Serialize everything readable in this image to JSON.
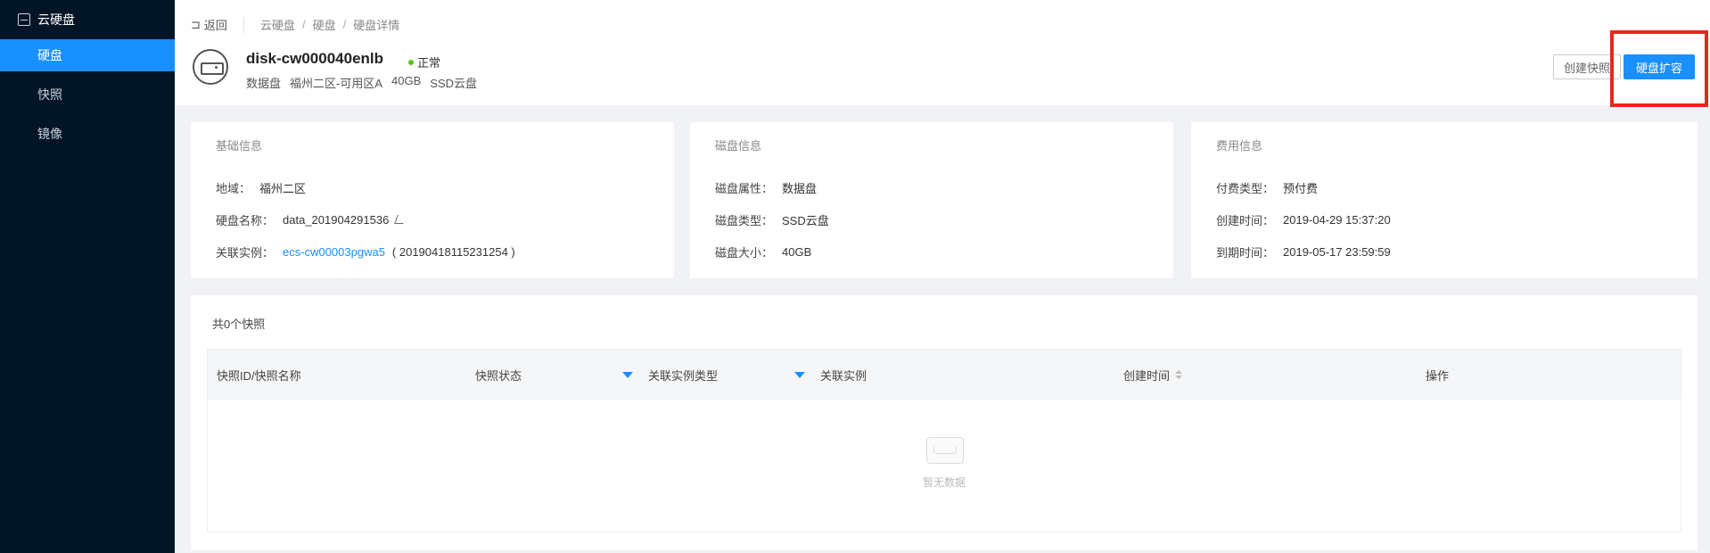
{
  "sidebar": {
    "title": "云硬盘",
    "items": [
      {
        "label": "硬盘",
        "active": true
      },
      {
        "label": "快照",
        "active": false
      },
      {
        "label": "镜像",
        "active": false
      }
    ]
  },
  "header": {
    "back_label": "返回",
    "breadcrumbs": [
      "云硬盘",
      "硬盘",
      "硬盘详情"
    ],
    "disk_name": "disk-cw000040enlb",
    "status": "正常",
    "meta": [
      "数据盘",
      "福州二区-可用区A",
      "40GB",
      "SSD云盘"
    ],
    "create_snapshot_label": "创建快照",
    "expand_label": "硬盘扩容"
  },
  "basic_info": {
    "title": "基础信息",
    "region_key": "地域：",
    "region_value": "福州二区",
    "name_key": "硬盘名称：",
    "name_value": "data_201904291536",
    "instance_key": "关联实例：",
    "instance_link": "ecs-cw00003pgwa5",
    "instance_id": "( 20190418115231254 )"
  },
  "disk_info": {
    "title": "磁盘信息",
    "attr_key": "磁盘属性：",
    "attr_value": "数据盘",
    "type_key": "磁盘类型：",
    "type_value": "SSD云盘",
    "size_key": "磁盘大小：",
    "size_value": "40GB"
  },
  "billing_info": {
    "title": "费用信息",
    "pay_key": "付费类型：",
    "pay_value": "预付费",
    "created_key": "创建时间：",
    "created_value": "2019-04-29 15:37:20",
    "expire_key": "到期时间：",
    "expire_value": "2019-05-17 23:59:59"
  },
  "snapshots": {
    "count_label": "共0个快照",
    "columns": [
      "快照ID/快照名称",
      "快照状态",
      "关联实例类型",
      "关联实例",
      "创建时间",
      "操作"
    ],
    "empty_text": "暂无数据"
  },
  "colors": {
    "accent": "#1890ff",
    "sidebar_bg": "#021527",
    "status_ok": "#52c41a",
    "highlight": "#e8261f"
  }
}
